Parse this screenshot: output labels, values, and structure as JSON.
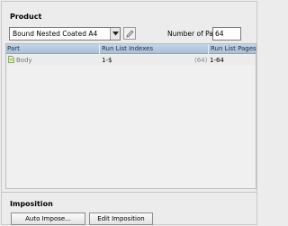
{
  "product": {
    "title": "Product",
    "dropdown_value": "Bound Nested Coated A4",
    "pages_label": "Number of Pages:",
    "pages_value": "64"
  },
  "table": {
    "headers": {
      "part": "Part",
      "indexes": "Run List Indexes",
      "pages": "Run List Pages"
    },
    "rows": [
      {
        "part": "Body",
        "indexes": "1-$",
        "count": "(64)",
        "pages": "1-64"
      }
    ]
  },
  "imposition": {
    "title": "Imposition",
    "auto_label": "Auto Impose...",
    "edit_label": "Edit Imposition"
  },
  "icons": {
    "dropdown": "chevron-down-icon",
    "edit": "pencil-icon",
    "part": "document-icon"
  }
}
